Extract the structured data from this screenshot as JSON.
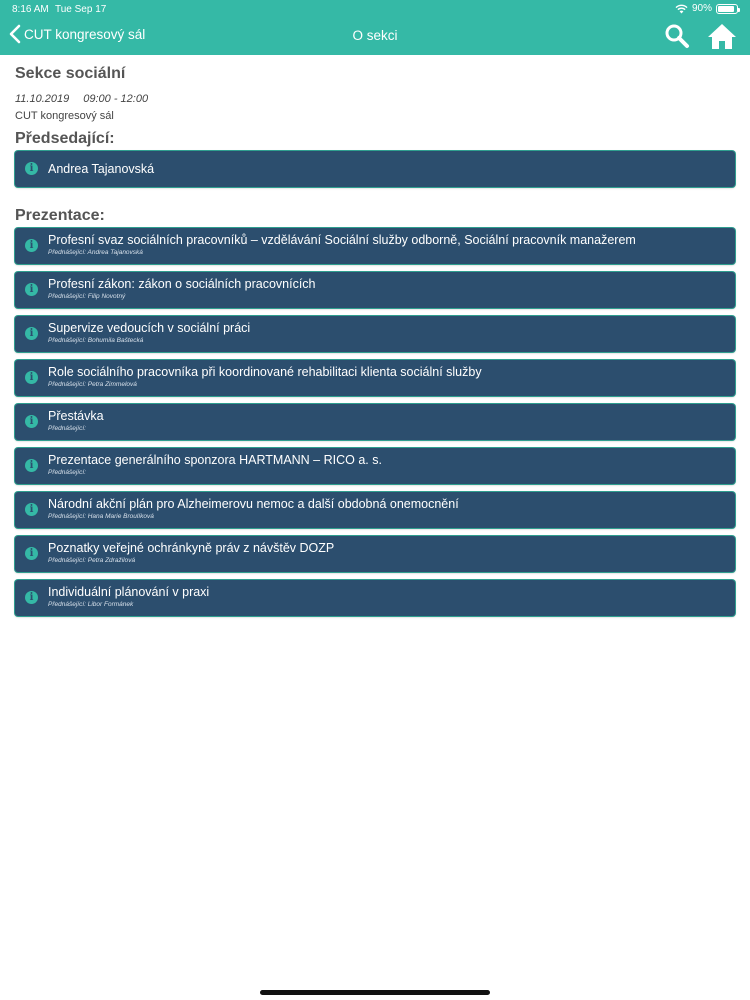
{
  "status_bar": {
    "time": "8:16 AM",
    "date": "Tue Sep 17",
    "battery_text": "90%",
    "battery_level": 0.9
  },
  "nav": {
    "back_label": "CUT kongresový sál",
    "title": "O sekci",
    "icons": [
      "chevron-left-icon",
      "search-icon",
      "home-icon"
    ]
  },
  "section": {
    "title": "Sekce sociální",
    "date": "11.10.2019",
    "time": "09:00 - 12:00",
    "room": "CUT kongresový sál"
  },
  "chairs": {
    "heading": "Předsedající:",
    "items": [
      {
        "name": "Andrea Tajanovská"
      }
    ]
  },
  "presentations": {
    "heading": "Prezentace:",
    "speaker_prefix": "Přednášející:",
    "items": [
      {
        "title": "Profesní svaz sociálních pracovníků – vzdělávání Sociální služby odborně, Sociální pracovník manažerem",
        "speaker": "Přednášející: Andrea Tajanovská"
      },
      {
        "title": "Profesní zákon: zákon o sociálních pracovnících",
        "speaker": "Přednášející: Filip Novotný"
      },
      {
        "title": "Supervize vedoucích v sociální práci",
        "speaker": "Přednášející: Bohumila Baštecká"
      },
      {
        "title": "Role sociálního pracovníka při koordinované rehabilitaci klienta sociální služby",
        "speaker": "Přednášející: Petra Zimmelová"
      },
      {
        "title": "Přestávka",
        "speaker": "Přednášející:"
      },
      {
        "title": "Prezentace generálního sponzora HARTMANN – RICO a. s.",
        "speaker": "Přednášející:"
      },
      {
        "title": "Národní akční plán pro Alzheimerovu nemoc a další obdobná onemocnění",
        "speaker": "Přednášející: Hana Marie Broulíková"
      },
      {
        "title": "Poznatky veřejné ochránkyně práv z návštěv DOZP",
        "speaker": "Přednášející: Petra Zdražilová"
      },
      {
        "title": "Individuální plánování v praxi",
        "speaker": "Přednášející: Libor Formánek"
      }
    ]
  },
  "colors": {
    "header": "#35b9a6",
    "card": "#2c4e6e",
    "info_icon": "#35b9a6"
  }
}
